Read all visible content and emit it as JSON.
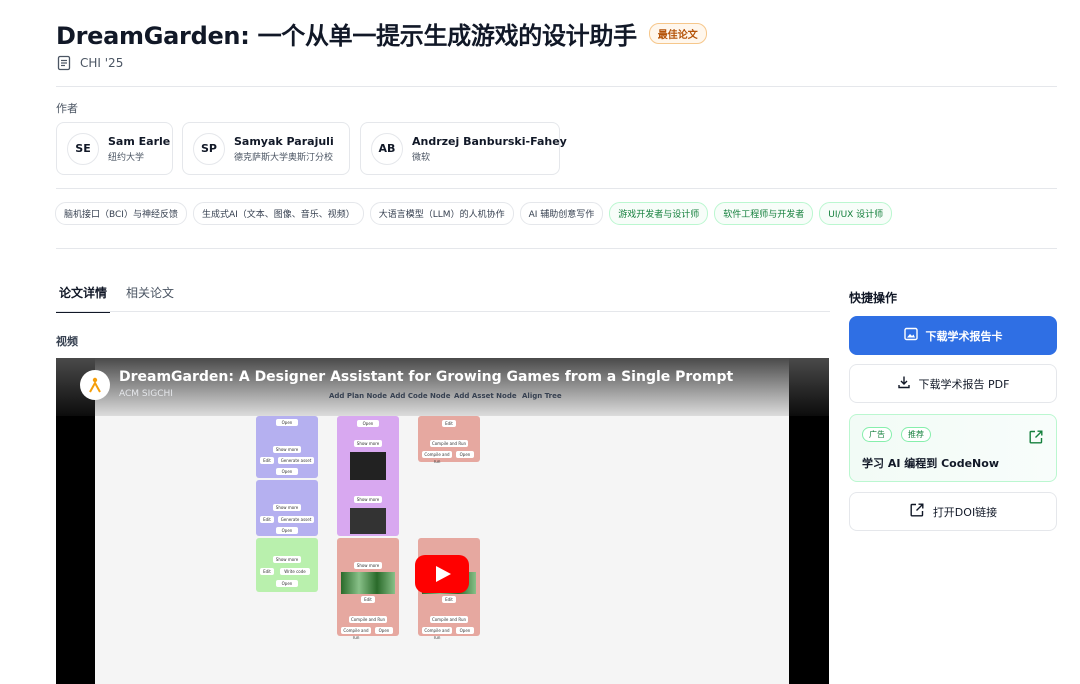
{
  "paper": {
    "title": "DreamGarden: 一个从单一提示生成游戏的设计助手",
    "badge": "最佳论文",
    "venue": "CHI '25"
  },
  "authors_label": "作者",
  "authors": [
    {
      "initials": "SE",
      "name": "Sam Earle",
      "affiliation": "纽约大学"
    },
    {
      "initials": "SP",
      "name": "Samyak Parajuli",
      "affiliation": "德克萨斯大学奥斯汀分校"
    },
    {
      "initials": "AB",
      "name": "Andrzej Banburski-Fahey",
      "affiliation": "微软"
    }
  ],
  "tags": [
    "脑机接口（BCI）与神经反馈",
    "生成式AI（文本、图像、音乐、视频）",
    "大语言模型（LLM）的人机协作",
    "AI 辅助创意写作",
    "游戏开发者与设计师",
    "软件工程师与开发者",
    "UI/UX 设计师"
  ],
  "tabs": [
    "论文详情",
    "相关论文"
  ],
  "video_label": "视频",
  "video": {
    "title": "DreamGarden: A Designer Assistant for Growing Games from a Single Prompt",
    "channel": "ACM SIGCHI",
    "menu": [
      "Add Plan Node",
      "Add Code Node",
      "Add Asset Node",
      "Align Tree"
    ]
  },
  "sidebar": {
    "title": "快捷操作",
    "download_card": "下载学术报告卡",
    "download_pdf": "下载学术报告 PDF",
    "ad": {
      "tag_ad": "广告",
      "tag_rec": "推荐",
      "title": "学习 AI 编程到 CodeNow"
    },
    "doi": "打开DOI链接"
  },
  "colors": {
    "primary": "#2f6fe4",
    "green_tag": "#15803d",
    "badge": "#b45309"
  }
}
